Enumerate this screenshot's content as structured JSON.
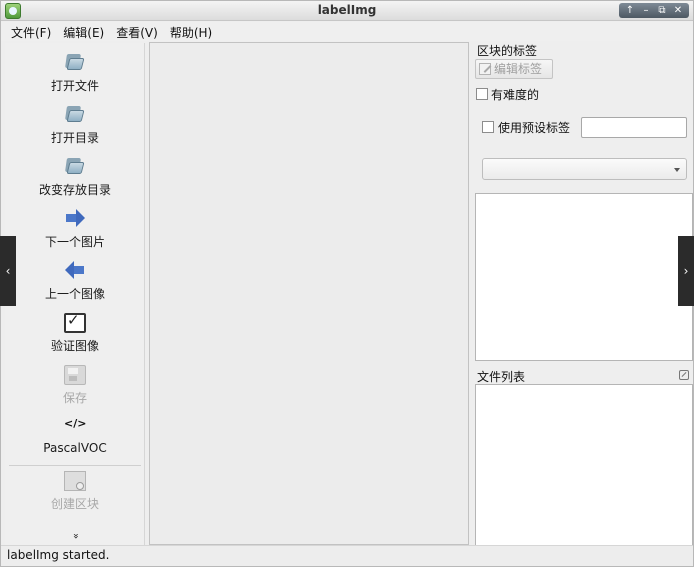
{
  "window": {
    "title": "labelImg",
    "controls": {
      "up": "↑",
      "minimize": "–",
      "restore": "⧉",
      "close": "✕"
    }
  },
  "menu": [
    "文件(F)",
    "编辑(E)",
    "查看(V)",
    "帮助(H)"
  ],
  "toolbar": {
    "open_file": "打开文件",
    "open_dir": "打开目录",
    "change_save_dir": "改变存放目录",
    "next_image": "下一个图片",
    "prev_image": "上一个图像",
    "verify_image": "验证图像",
    "save": "保存",
    "format": "PascalVOC",
    "format_icon_text": "</>",
    "create_box": "创建区块",
    "more_icon_text": "»"
  },
  "right_panel": {
    "box_labels_title": "区块的标签",
    "edit_label_button": "编辑标签",
    "difficult_label": "有难度的",
    "use_default_label": "使用预设标签",
    "default_label_value": "",
    "label_combo_value": "",
    "file_list_title": "文件列表"
  },
  "status": {
    "text": "labelImg started."
  },
  "overlay": {
    "prev_arrow": "‹",
    "next_arrow": "›"
  },
  "colors": {
    "arrow_blue": "#4b77c9",
    "folder_blue": "#8fb0c4",
    "canvas_bg": "#ececec"
  }
}
